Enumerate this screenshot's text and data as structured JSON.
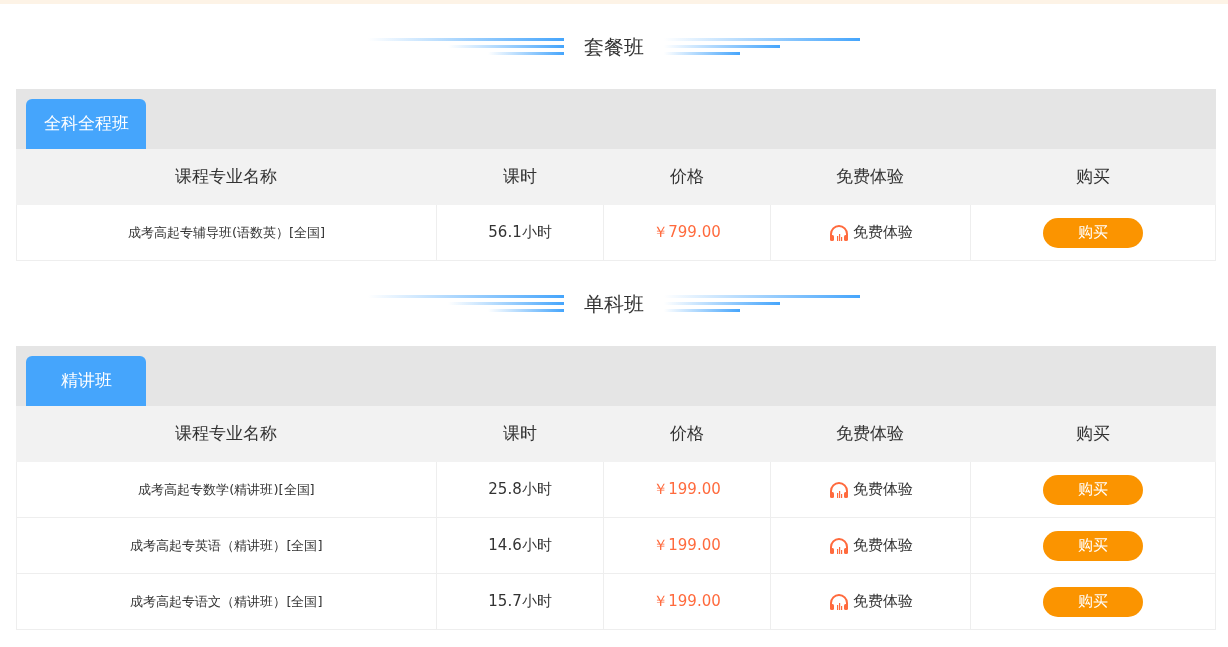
{
  "sections": [
    {
      "title": "套餐班",
      "tabs": [
        {
          "label": "全科全程班",
          "selected": true
        }
      ],
      "columns": [
        "课程专业名称",
        "课时",
        "价格",
        "免费体验",
        "购买"
      ],
      "rows": [
        {
          "name": "成考高起专辅导班(语数英）[全国]",
          "hours": "56.1小时",
          "price": "￥799.00",
          "trial": "免费体验",
          "buy": "购买"
        }
      ]
    },
    {
      "title": "单科班",
      "tabs": [
        {
          "label": "精讲班",
          "selected": true
        }
      ],
      "columns": [
        "课程专业名称",
        "课时",
        "价格",
        "免费体验",
        "购买"
      ],
      "rows": [
        {
          "name": "成考高起专数学(精讲班)[全国]",
          "hours": "25.8小时",
          "price": "￥199.00",
          "trial": "免费体验",
          "buy": "购买"
        },
        {
          "name": "成考高起专英语（精讲班）[全国]",
          "hours": "14.6小时",
          "price": "￥199.00",
          "trial": "免费体验",
          "buy": "购买"
        },
        {
          "name": "成考高起专语文（精讲班）[全国]",
          "hours": "15.7小时",
          "price": "￥199.00",
          "trial": "免费体验",
          "buy": "购买"
        }
      ]
    }
  ]
}
